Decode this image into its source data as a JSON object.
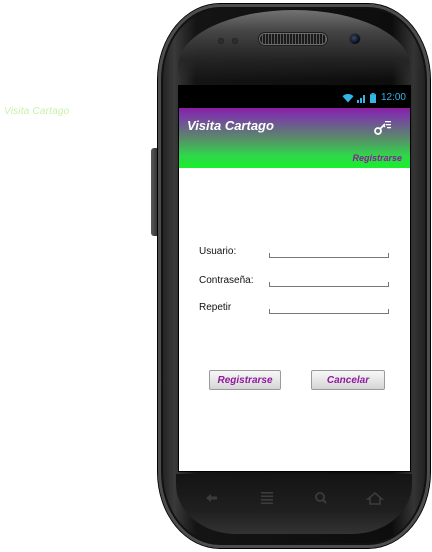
{
  "side_label": "Visita Cartago",
  "status_bar": {
    "time": "12:00",
    "icons": [
      "wifi-icon",
      "signal-icon",
      "battery-icon"
    ],
    "accent_color": "#33b5e5"
  },
  "action_bar": {
    "title": "Visita Cartago",
    "menu_icon": "key-menu-icon",
    "register_link": "Registrarse",
    "gradient_top": "#8b1da0",
    "gradient_bottom": "#18f02c"
  },
  "form": {
    "fields": [
      {
        "label": "Usuario:",
        "value": ""
      },
      {
        "label": "Contraseña:",
        "value": ""
      },
      {
        "label": "Repetir",
        "value": ""
      }
    ]
  },
  "buttons": {
    "register": "Registrarse",
    "cancel": "Cancelar",
    "text_color": "#8e1a9c"
  },
  "nav": {
    "icons": [
      "back-icon",
      "menu-icon",
      "search-icon",
      "home-icon"
    ]
  }
}
